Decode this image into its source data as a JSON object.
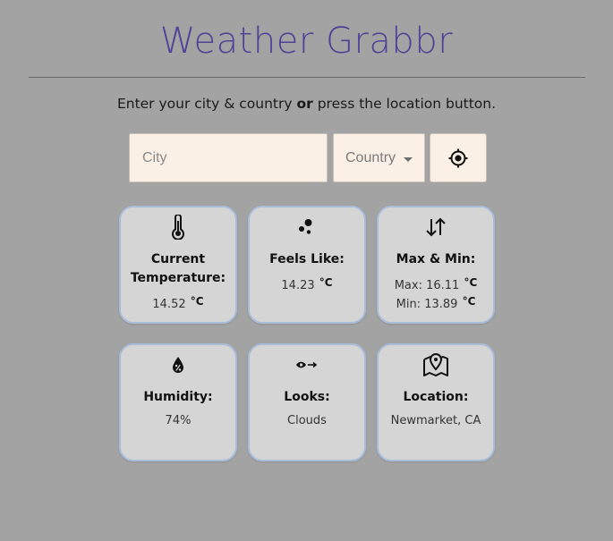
{
  "header": {
    "title": "Weather Grabbr",
    "instructions_before": "Enter your city & country ",
    "instructions_bold": "or",
    "instructions_after": " press the location button."
  },
  "search": {
    "city_placeholder": "City",
    "country_label": "Country",
    "locate_icon": "gps-crosshair-icon"
  },
  "cards": {
    "temperature": {
      "icon": "thermometer-icon",
      "title_line1": "Current",
      "title_line2": "Temperature:",
      "value": "14.52",
      "unit": "°C"
    },
    "feels_like": {
      "icon": "bubbles-icon",
      "title": "Feels Like:",
      "value": "14.23",
      "unit": "°C"
    },
    "max_min": {
      "icon": "up-down-arrows-icon",
      "title": "Max & Min:",
      "max_label": "Max: ",
      "max_value": "16.11",
      "min_label": "Min: ",
      "min_value": "13.89",
      "unit": "°C"
    },
    "humidity": {
      "icon": "humidity-drop-icon",
      "title": "Humidity:",
      "value": "74%"
    },
    "looks": {
      "icon": "eye-arrow-icon",
      "title": "Looks:",
      "value": "Clouds"
    },
    "location": {
      "icon": "map-pin-icon",
      "title": "Location:",
      "value": "Newmarket, CA"
    }
  },
  "colors": {
    "background": "#a3a3a3",
    "title": "#4f4396",
    "input_background": "#fbf0e6",
    "card_background": "#d5d5d5",
    "card_border": "#a8bdd9"
  }
}
